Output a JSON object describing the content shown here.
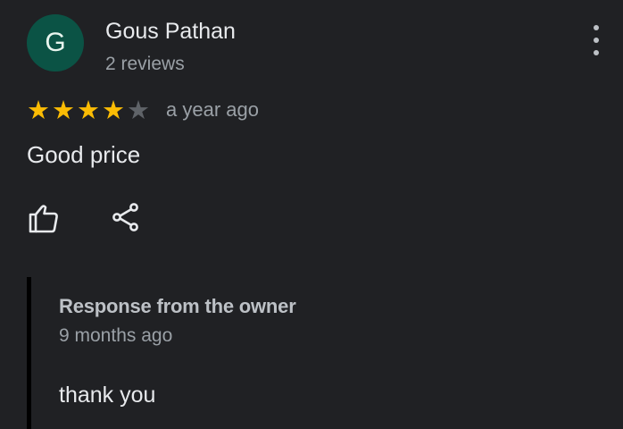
{
  "review": {
    "author": {
      "initial": "G",
      "name": "Gous Pathan",
      "reviews_count": "2 reviews",
      "avatar_color": "#0b5345"
    },
    "rating": 4,
    "rating_max": 5,
    "time": "a year ago",
    "text": "Good price",
    "actions": [
      {
        "name": "like",
        "icon": "thumbs-up-icon"
      },
      {
        "name": "share",
        "icon": "share-icon"
      }
    ],
    "menu_icon": "more-vert-icon"
  },
  "owner_response": {
    "title": "Response from the owner",
    "time": "9 months ago",
    "text": "thank you"
  },
  "colors": {
    "background": "#202124",
    "star_filled": "#fbbc04",
    "star_empty": "#5f6368",
    "secondary_text": "#9aa0a6"
  }
}
